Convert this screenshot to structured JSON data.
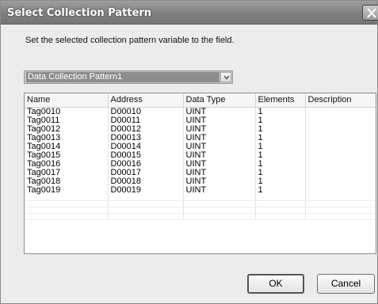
{
  "dialog": {
    "title": "Select Collection Pattern",
    "instruction": "Set the selected collection pattern variable to the field.",
    "pattern_select": {
      "value": "Data Collection Pattern1"
    },
    "table": {
      "columns": [
        "Name",
        "Address",
        "Data Type",
        "Elements",
        "Description"
      ],
      "rows": [
        [
          "Tag0010",
          "D00010",
          "UINT",
          "1",
          ""
        ],
        [
          "Tag0011",
          "D00011",
          "UINT",
          "1",
          ""
        ],
        [
          "Tag0012",
          "D00012",
          "UINT",
          "1",
          ""
        ],
        [
          "Tag0013",
          "D00013",
          "UINT",
          "1",
          ""
        ],
        [
          "Tag0014",
          "D00014",
          "UINT",
          "1",
          ""
        ],
        [
          "Tag0015",
          "D00015",
          "UINT",
          "1",
          ""
        ],
        [
          "Tag0016",
          "D00016",
          "UINT",
          "1",
          ""
        ],
        [
          "Tag0017",
          "D00017",
          "UINT",
          "1",
          ""
        ],
        [
          "Tag0018",
          "D00018",
          "UINT",
          "1",
          ""
        ],
        [
          "Tag0019",
          "D00019",
          "UINT",
          "1",
          ""
        ]
      ]
    },
    "buttons": {
      "ok": "OK",
      "cancel": "Cancel"
    },
    "icons": {
      "close": "close-icon",
      "dropdown": "chevron-down-icon"
    }
  }
}
